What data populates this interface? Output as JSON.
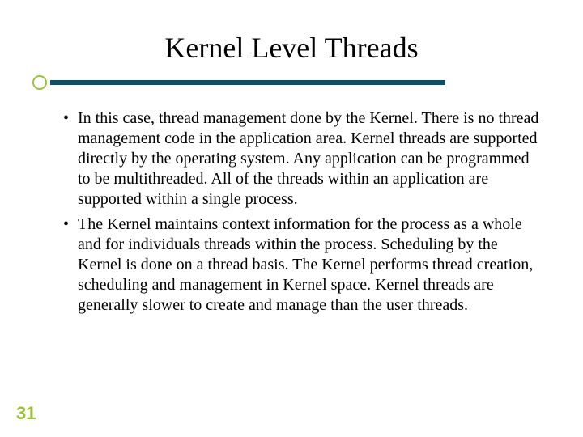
{
  "slide": {
    "title": "Kernel Level Threads",
    "bullets": [
      "In this case, thread management done by the Kernel. There is no thread management code in the application area. Kernel threads are supported directly by the operating system. Any application can be programmed to be multithreaded. All of the threads within an application are supported within a single process.",
      "The Kernel maintains context information for the process as a whole and for individuals threads within the process. Scheduling by the Kernel is done on a thread basis. The Kernel performs thread creation, scheduling and management in Kernel space. Kernel threads are generally slower to create and manage than the user threads."
    ],
    "page_number": "31",
    "colors": {
      "accent_green": "#9fbf3a",
      "rule_teal": "#0d4f66"
    }
  }
}
